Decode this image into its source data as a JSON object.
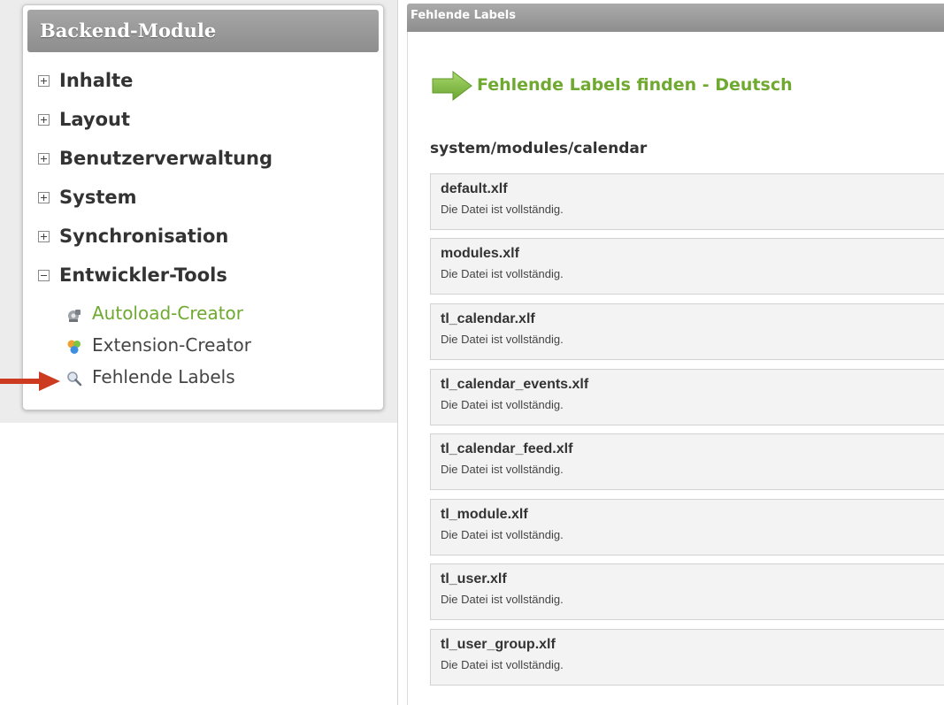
{
  "sidebar": {
    "title": "Backend-Module",
    "groups": [
      {
        "label": "Inhalte",
        "state": "collapsed"
      },
      {
        "label": "Layout",
        "state": "collapsed"
      },
      {
        "label": "Benutzerverwaltung",
        "state": "collapsed"
      },
      {
        "label": "System",
        "state": "collapsed"
      },
      {
        "label": "Synchronisation",
        "state": "collapsed"
      },
      {
        "label": "Entwickler-Tools",
        "state": "expanded"
      }
    ],
    "subitems": [
      {
        "label": "Autoload-Creator",
        "icon": "gear-icon",
        "active": true
      },
      {
        "label": "Extension-Creator",
        "icon": "puzzle-icon",
        "active": false
      },
      {
        "label": "Fehlende Labels",
        "icon": "magnifier-icon",
        "active": false
      }
    ]
  },
  "content": {
    "header_title": "Fehlende Labels",
    "headline": "Fehlende Labels finden - Deutsch",
    "path": "system/modules/calendar",
    "files": [
      {
        "name": "default.xlf",
        "status": "Die Datei ist vollständig."
      },
      {
        "name": "modules.xlf",
        "status": "Die Datei ist vollständig."
      },
      {
        "name": "tl_calendar.xlf",
        "status": "Die Datei ist vollständig."
      },
      {
        "name": "tl_calendar_events.xlf",
        "status": "Die Datei ist vollständig."
      },
      {
        "name": "tl_calendar_feed.xlf",
        "status": "Die Datei ist vollständig."
      },
      {
        "name": "tl_module.xlf",
        "status": "Die Datei ist vollständig."
      },
      {
        "name": "tl_user.xlf",
        "status": "Die Datei ist vollständig."
      },
      {
        "name": "tl_user_group.xlf",
        "status": "Die Datei ist vollständig."
      }
    ]
  },
  "colors": {
    "accent_green": "#6fa92f",
    "header_gray": "#9a9a9a",
    "annotation_arrow": "#cc3b1f"
  }
}
